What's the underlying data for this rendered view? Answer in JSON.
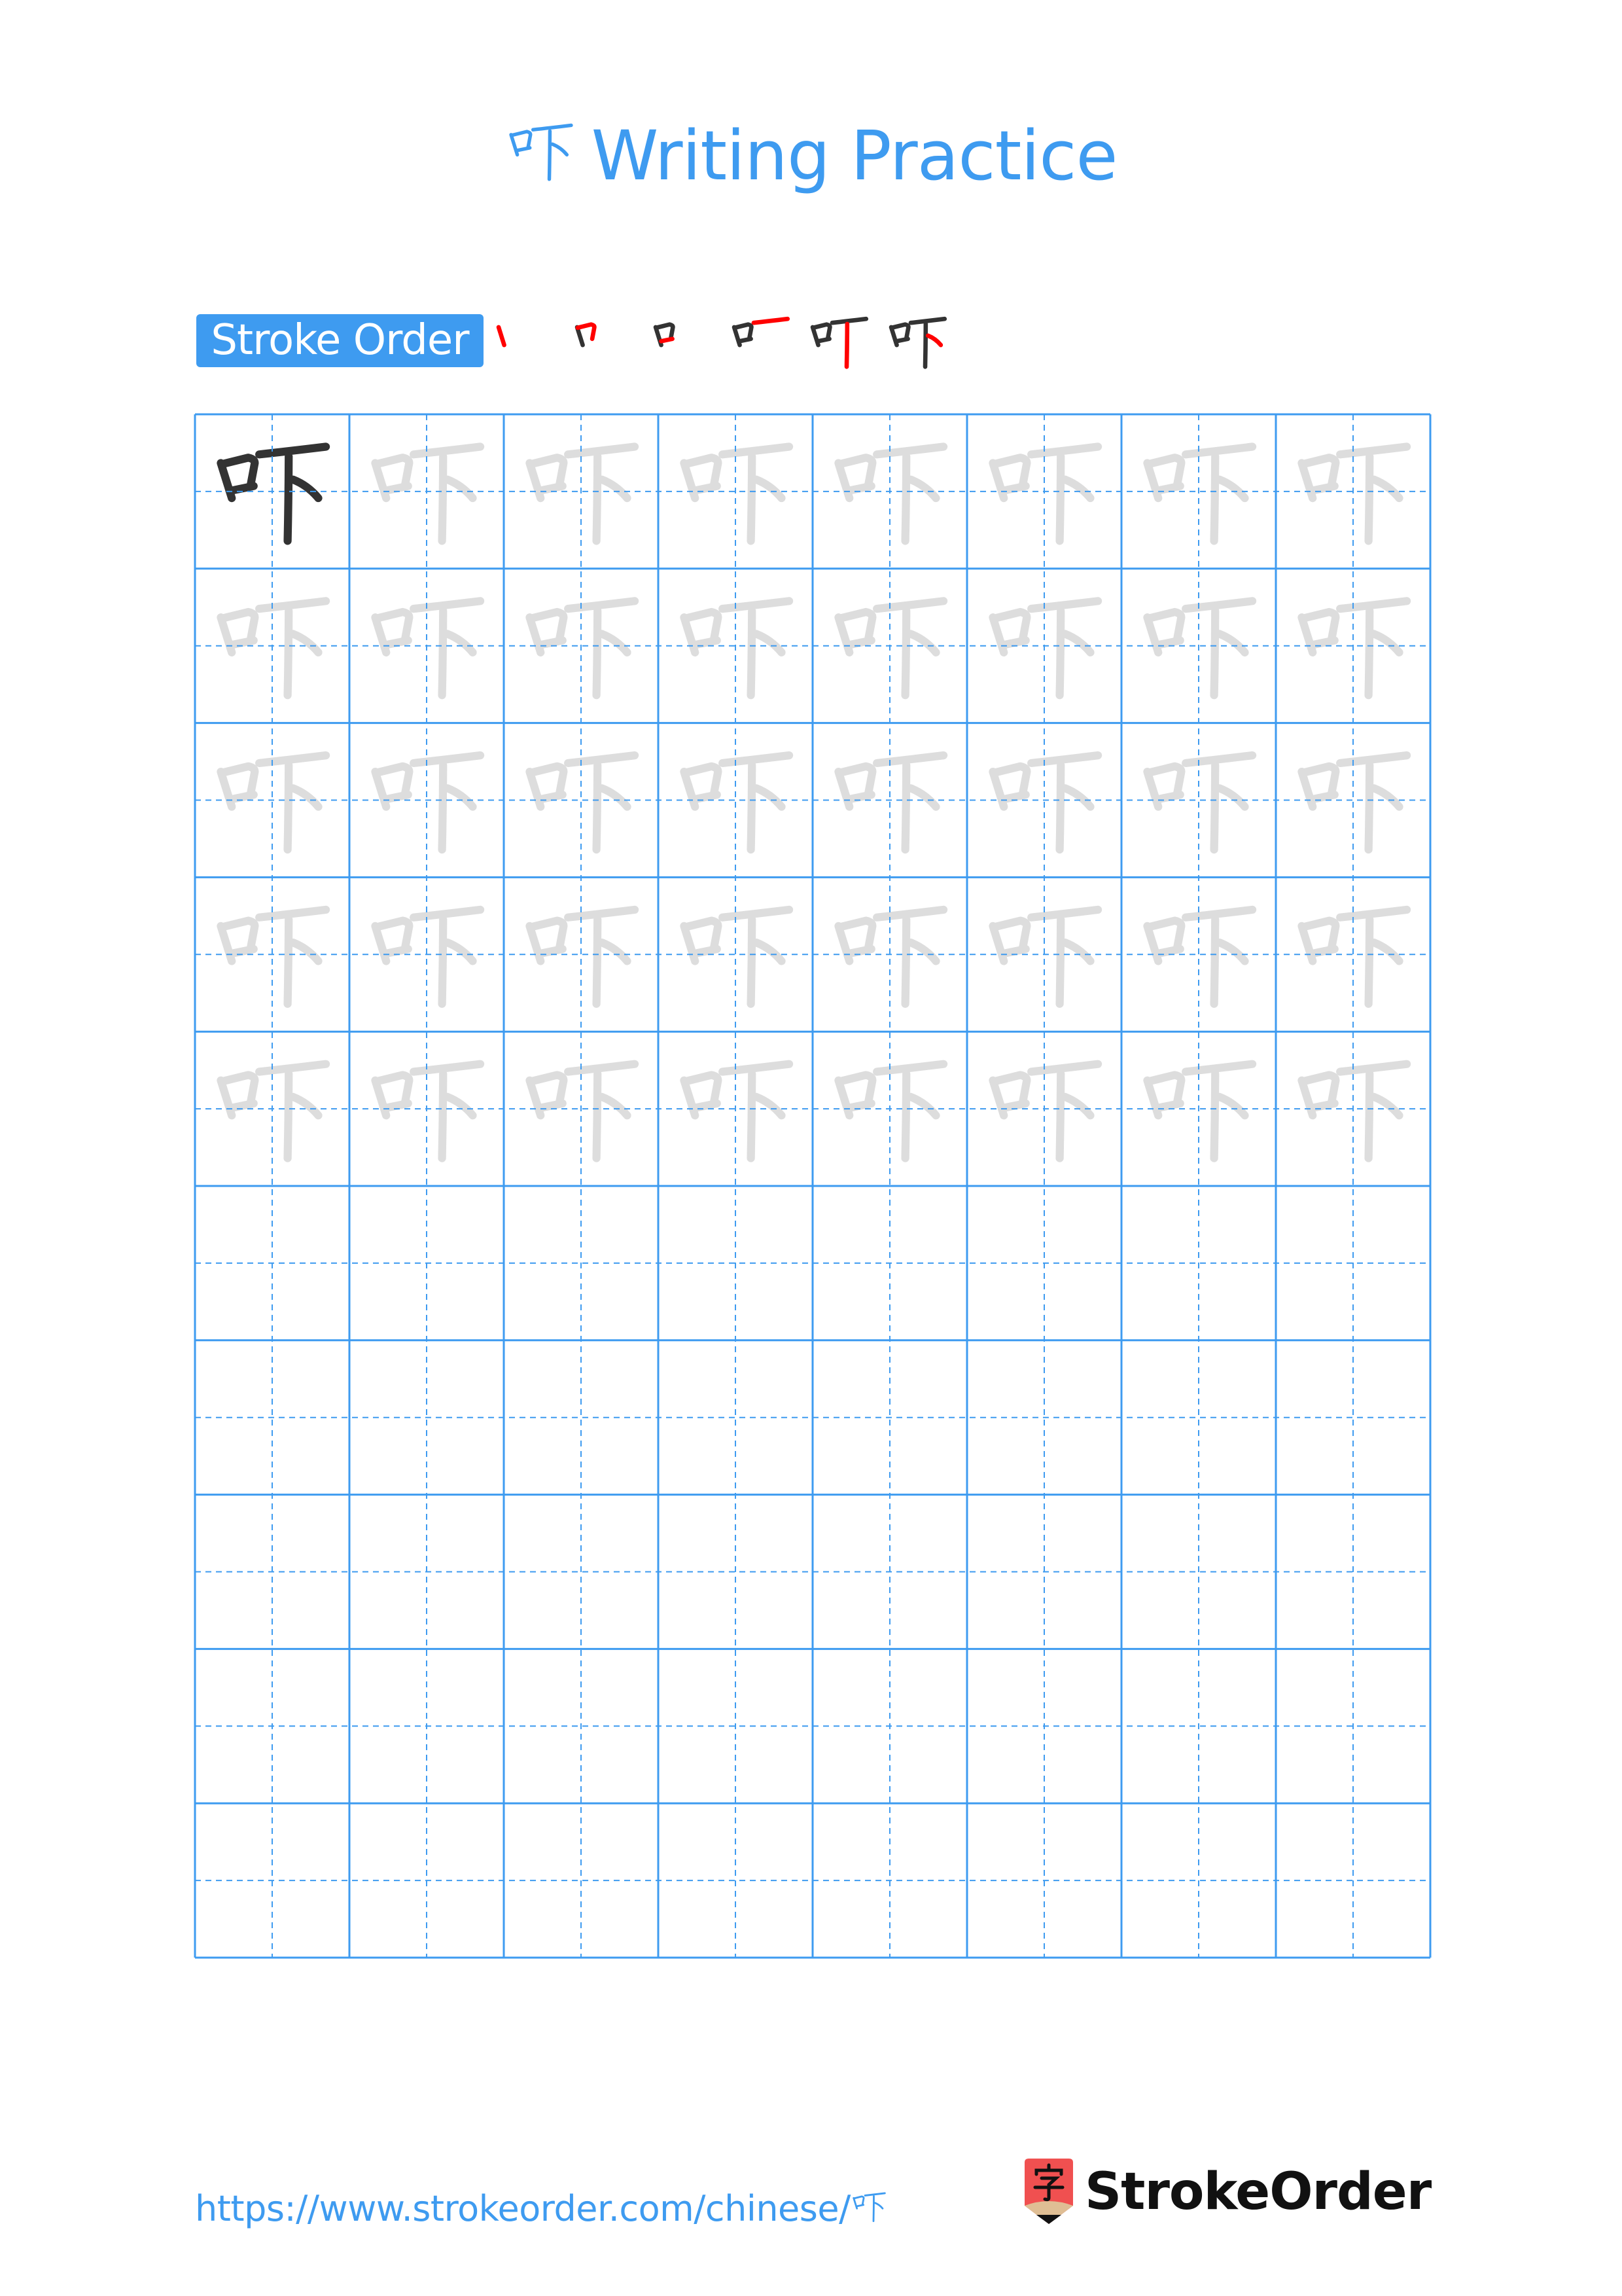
{
  "page": {
    "title_char": "吓",
    "title_text": "Writing Practice",
    "stroke_order_label": "Stroke Order",
    "stroke_count": 6,
    "colors": {
      "accent": "#3e9bf0",
      "model_char": "#333333",
      "trace_char": "#dddddd",
      "highlight_stroke": "#ff0000",
      "logo_red": "#f05050",
      "logo_tan": "#dfbe94"
    }
  },
  "grid": {
    "rows": 10,
    "cols": 8,
    "model_cells": 1,
    "traced_rows": 5,
    "character": "吓"
  },
  "footer": {
    "url": "https://www.strokeorder.com/chinese/",
    "url_char": "吓",
    "logo_glyph": "字",
    "logo_text": "StrokeOrder"
  }
}
